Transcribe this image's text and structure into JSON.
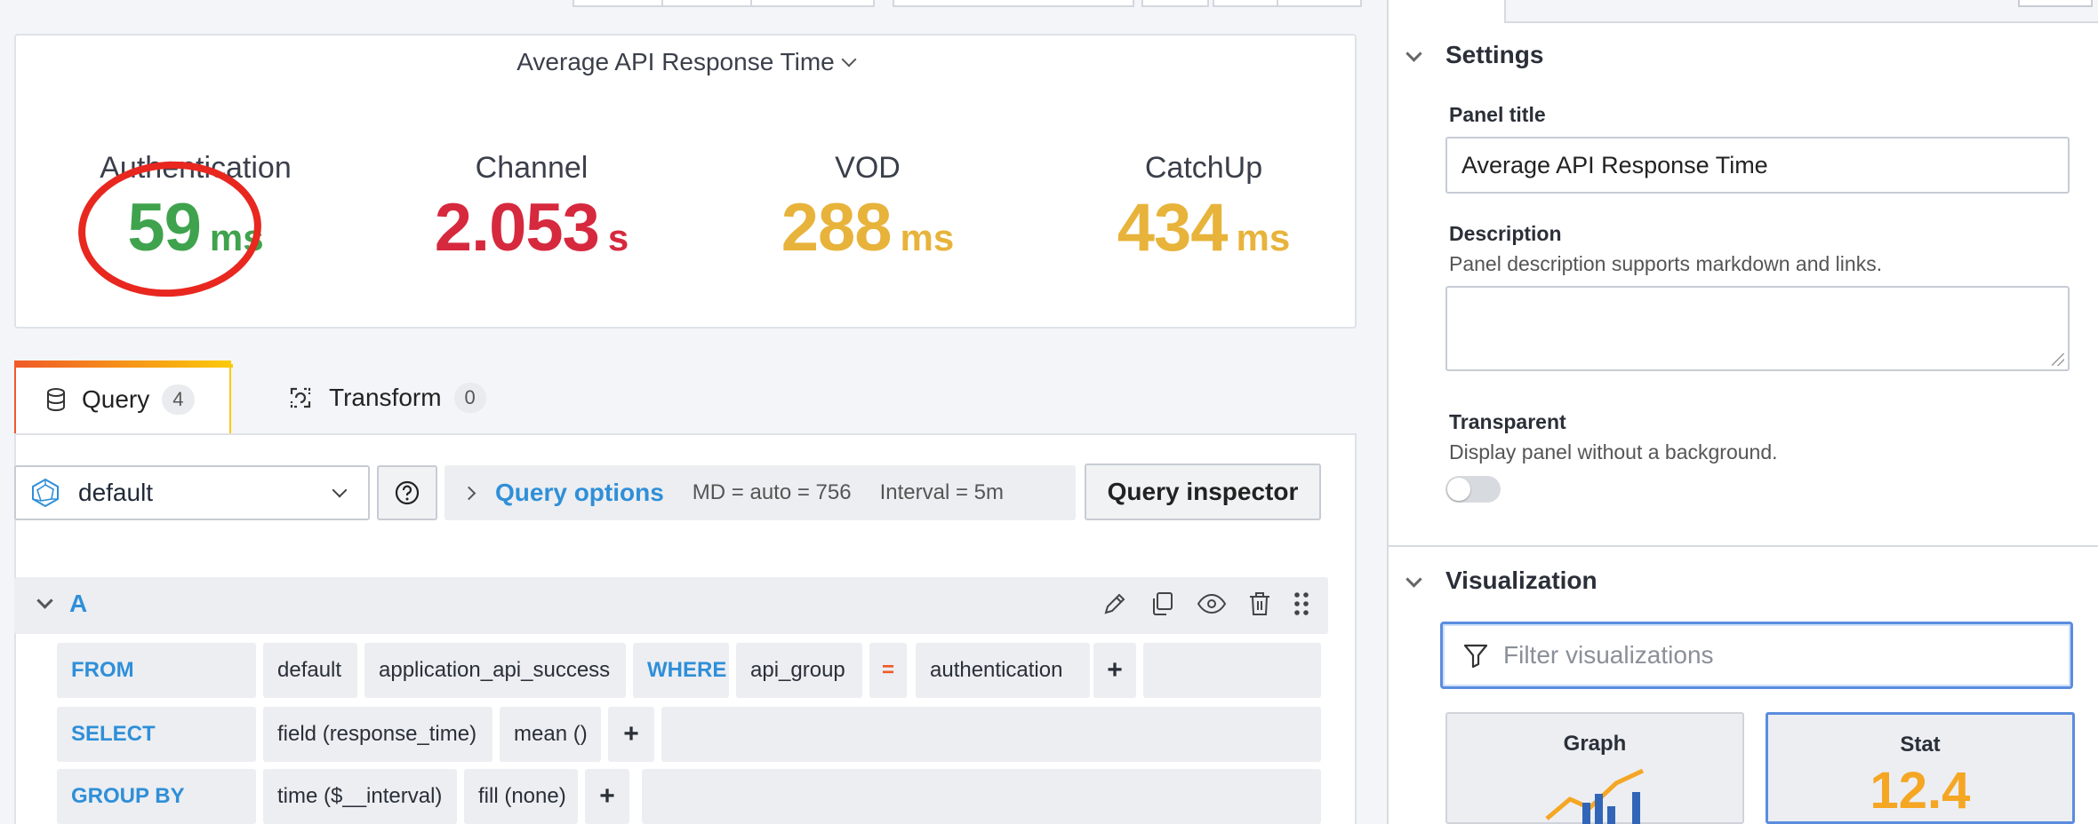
{
  "panel": {
    "title": "Average API Response Time",
    "stats": [
      {
        "name": "Authentication",
        "value": "59",
        "unit": "ms",
        "color": "#3fa34d"
      },
      {
        "name": "Channel",
        "value": "2.053",
        "unit": "s",
        "color": "#d6293e"
      },
      {
        "name": "VOD",
        "value": "288",
        "unit": "ms",
        "color": "#e8b33a"
      },
      {
        "name": "CatchUp",
        "value": "434",
        "unit": "ms",
        "color": "#e8b33a"
      }
    ]
  },
  "tabs": [
    {
      "label": "Query",
      "count": "4"
    },
    {
      "label": "Transform",
      "count": "0"
    }
  ],
  "query_toolbar": {
    "datasource": "default",
    "options_label": "Query options",
    "md": "MD = auto = 756",
    "interval": "Interval = 5m",
    "inspector_label": "Query inspector"
  },
  "query": {
    "ref_id": "A",
    "from": {
      "kw": "FROM",
      "policy": "default",
      "measurement": "application_api_success",
      "where_kw": "WHERE",
      "tag": "api_group",
      "op": "=",
      "value": "authentication"
    },
    "select": {
      "kw": "SELECT",
      "field": "field (response_time)",
      "fn": "mean ()"
    },
    "group_by": {
      "kw": "GROUP BY",
      "time": "time ($__interval)",
      "fill": "fill (none)"
    },
    "plus": "+"
  },
  "settings": {
    "section_title": "Settings",
    "panel_title_label": "Panel title",
    "panel_title_value": "Average API Response Time",
    "description_label": "Description",
    "description_help": "Panel description supports markdown and links.",
    "transparent_label": "Transparent",
    "transparent_help": "Display panel without a background."
  },
  "visualization": {
    "section_title": "Visualization",
    "filter_placeholder": "Filter visualizations",
    "cards": [
      {
        "name": "Graph"
      },
      {
        "name": "Stat",
        "preview": "12.4"
      }
    ]
  },
  "colors": {
    "accent_blue": "#2f8fd8",
    "annotation_red": "#e8271f"
  }
}
